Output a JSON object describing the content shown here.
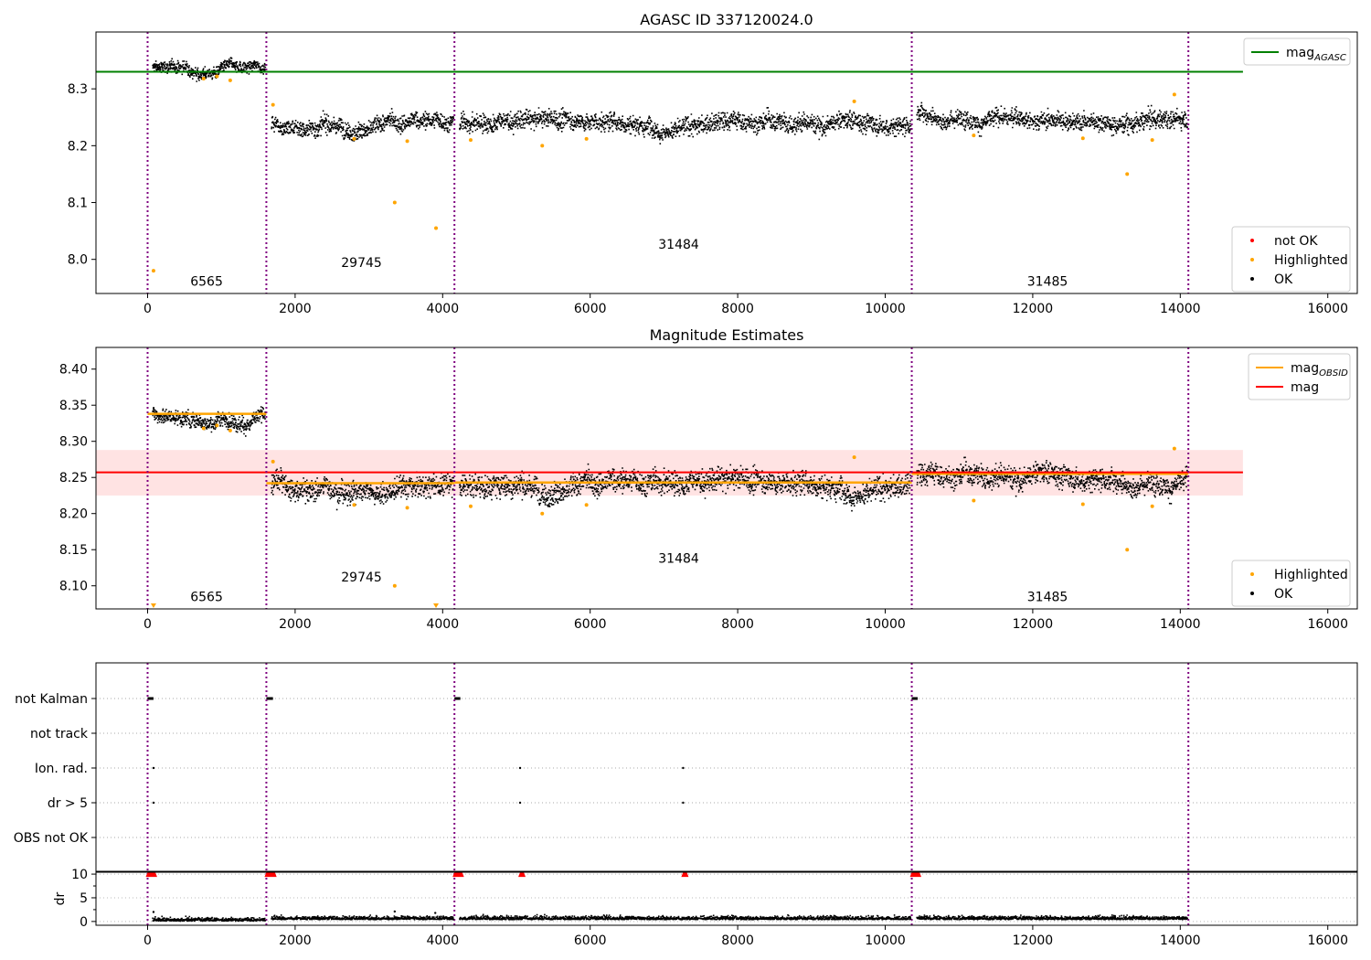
{
  "figure": {
    "title": "AGASC ID 337120024.0"
  },
  "chart_data": [
    {
      "type": "scatter",
      "title": "AGASC ID 337120024.0",
      "xlim": [
        -700,
        16400
      ],
      "ylim": [
        7.94,
        8.4
      ],
      "xticks": [
        0,
        2000,
        4000,
        6000,
        8000,
        10000,
        12000,
        14000,
        16000
      ],
      "yticks": [
        8.0,
        8.1,
        8.2,
        8.3
      ],
      "boundaries": [
        0,
        1610,
        4160,
        10360,
        14110
      ],
      "observations": [
        {
          "obsid": "6565",
          "start": 0,
          "end": 1610,
          "level": 8.338,
          "spread": 0.015,
          "label_pos": [
            800,
            7.962
          ]
        },
        {
          "obsid": "29745",
          "start": 1610,
          "end": 4160,
          "level": 8.242,
          "spread": 0.022,
          "label_pos": [
            2900,
            7.995
          ]
        },
        {
          "obsid": "31484",
          "start": 4160,
          "end": 10360,
          "level": 8.243,
          "spread": 0.024,
          "label_pos": [
            7200,
            8.027
          ]
        },
        {
          "obsid": "31485",
          "start": 10360,
          "end": 14110,
          "level": 8.255,
          "spread": 0.023,
          "label_pos": [
            12200,
            7.962
          ]
        }
      ],
      "highlighted_points": [
        [
          80,
          7.98
        ],
        [
          760,
          8.318
        ],
        [
          940,
          8.322
        ],
        [
          1120,
          8.315
        ],
        [
          1700,
          8.272
        ],
        [
          2800,
          8.212
        ],
        [
          3350,
          8.1
        ],
        [
          3520,
          8.208
        ],
        [
          3910,
          8.055
        ],
        [
          4380,
          8.21
        ],
        [
          5350,
          8.2
        ],
        [
          5950,
          8.212
        ],
        [
          9580,
          8.278
        ],
        [
          11200,
          8.218
        ],
        [
          12680,
          8.213
        ],
        [
          13280,
          8.15
        ],
        [
          13620,
          8.21
        ],
        [
          13920,
          8.29
        ]
      ],
      "hlines": [
        {
          "name": "mag_AGASC",
          "y": 8.33,
          "x0": -700,
          "x1": 14850,
          "color": "#008000"
        }
      ],
      "legend_upper": [
        {
          "label": "mag",
          "sub": "AGASC",
          "color": "#008000",
          "kind": "line"
        }
      ],
      "legend_lower": [
        {
          "label": "not OK",
          "color": "#ff0000",
          "kind": "marker"
        },
        {
          "label": "Highlighted",
          "color": "#ffa500",
          "kind": "marker"
        },
        {
          "label": "OK",
          "color": "#000000",
          "kind": "marker"
        }
      ]
    },
    {
      "type": "scatter",
      "title": "Magnitude Estimates",
      "xlim": [
        -700,
        16400
      ],
      "ylim": [
        8.068,
        8.43
      ],
      "xticks": [
        0,
        2000,
        4000,
        6000,
        8000,
        10000,
        12000,
        14000,
        16000
      ],
      "yticks": [
        8.1,
        8.15,
        8.2,
        8.25,
        8.3,
        8.35,
        8.4
      ],
      "boundaries": [
        0,
        1610,
        4160,
        10360,
        14110
      ],
      "mag": 8.257,
      "mag_band": [
        8.225,
        8.288
      ],
      "mag_band_x": [
        -700,
        14850
      ],
      "mag_obsid": [
        {
          "x0": 0,
          "x1": 1610,
          "y": 8.338
        },
        {
          "x0": 1610,
          "x1": 4160,
          "y": 8.242
        },
        {
          "x0": 4160,
          "x1": 10360,
          "y": 8.243
        },
        {
          "x0": 10360,
          "x1": 14110,
          "y": 8.255
        }
      ],
      "obsid_labels": [
        {
          "obsid": "6565",
          "label_pos": [
            800,
            8.085
          ]
        },
        {
          "obsid": "29745",
          "label_pos": [
            2900,
            8.112
          ]
        },
        {
          "obsid": "31484",
          "label_pos": [
            7200,
            8.138
          ]
        },
        {
          "obsid": "31485",
          "label_pos": [
            12200,
            8.085
          ]
        }
      ],
      "legend_upper": [
        {
          "label": "mag",
          "sub": "OBSID",
          "color": "#ffa500",
          "kind": "line"
        },
        {
          "label": "mag",
          "sub": "",
          "color": "#ff0000",
          "kind": "line"
        }
      ],
      "legend_lower": [
        {
          "label": "Highlighted",
          "color": "#ffa500",
          "kind": "marker"
        },
        {
          "label": "OK",
          "color": "#000000",
          "kind": "marker"
        }
      ]
    },
    {
      "type": "scatter",
      "title": "",
      "xlim": [
        -700,
        16400
      ],
      "xticks": [
        0,
        2000,
        4000,
        6000,
        8000,
        10000,
        12000,
        14000,
        16000
      ],
      "boundaries": [
        0,
        1610,
        4160,
        10360,
        14110
      ],
      "flag_rows": [
        "not Kalman",
        "not track",
        "Ion. rad.",
        "dr > 5",
        "OBS not OK"
      ],
      "flag_points": {
        "not Kalman": [
          [
            0,
            80
          ],
          [
            1610,
            1700
          ],
          [
            4160,
            4240
          ],
          [
            10360,
            10440
          ]
        ],
        "not track": [],
        "Ion. rad.": [
          80,
          5050,
          7260
        ],
        "dr > 5": [
          80,
          5050,
          7260
        ],
        "OBS not OK": []
      },
      "dr_ylabel": "dr",
      "dr_ylim": [
        -0.8,
        10.4
      ],
      "dr_yticks": [
        0,
        5,
        10
      ],
      "dr_baseline": 0.4,
      "dr_clipped": [
        [
          0,
          80
        ],
        [
          1610,
          1700
        ],
        [
          4160,
          4240
        ],
        [
          10360,
          10440
        ],
        [
          5050,
          5050
        ],
        [
          7260,
          7260
        ]
      ],
      "dr_outliers": [
        [
          80,
          2.0
        ],
        [
          3350,
          2.1
        ],
        [
          3900,
          1.8
        ]
      ]
    }
  ]
}
